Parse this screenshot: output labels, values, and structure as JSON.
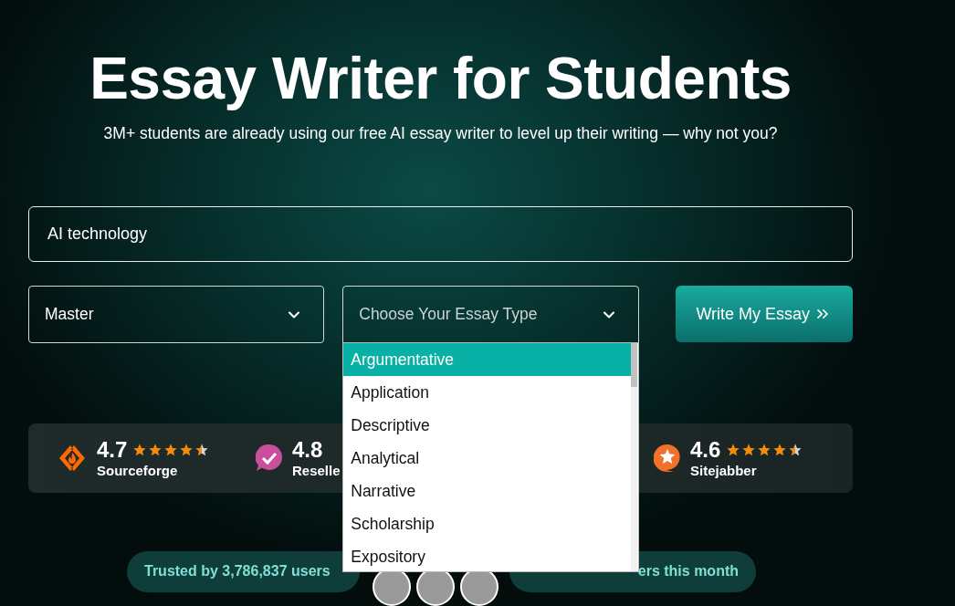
{
  "hero": {
    "title": "Essay Writer for Students",
    "subtitle": "3M+ students are already using our free AI essay writer to level up their writing — why not you?"
  },
  "topic_field": {
    "value": "AI technology"
  },
  "level_select": {
    "value": "Master"
  },
  "type_select": {
    "placeholder": "Choose Your Essay Type",
    "expanded": true,
    "options": [
      {
        "label": "Argumentative",
        "selected": true
      },
      {
        "label": "Application",
        "selected": false
      },
      {
        "label": "Descriptive",
        "selected": false
      },
      {
        "label": "Analytical",
        "selected": false
      },
      {
        "label": "Narrative",
        "selected": false
      },
      {
        "label": "Scholarship",
        "selected": false
      },
      {
        "label": "Expository",
        "selected": false
      }
    ]
  },
  "write_button": {
    "label": "Write My Essay"
  },
  "ratings": [
    {
      "kind": "sourceforge",
      "score": "4.7",
      "stars": 4.5,
      "name": "Sourceforge"
    },
    {
      "kind": "reseller",
      "score": "4.8",
      "name": "Reselle"
    },
    {
      "kind": "sitejabber",
      "score": "4.6",
      "stars": 4.5,
      "name": "Sitejabber"
    }
  ],
  "trust_pills": [
    "Trusted by 3,786,837 users",
    "ers this month"
  ]
}
